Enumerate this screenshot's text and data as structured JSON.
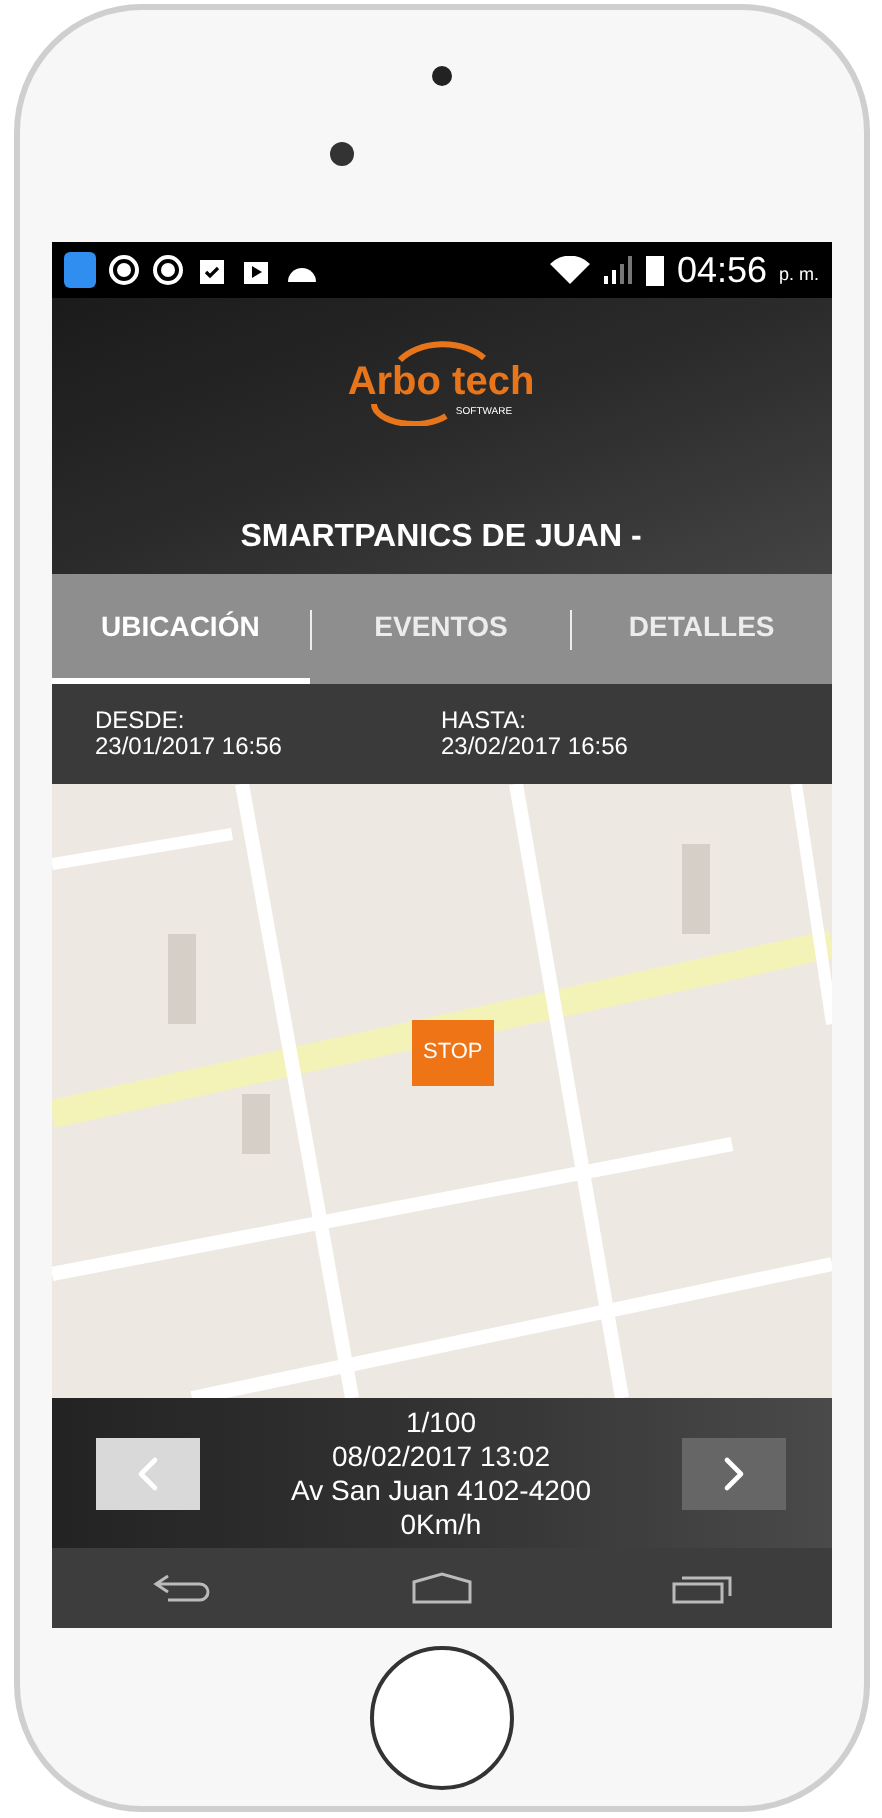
{
  "status_bar": {
    "time": "04:56",
    "meridiem": "p. m."
  },
  "header": {
    "logo": {
      "name": "Arbo tech",
      "tagline": "SOFTWARE"
    },
    "title": "SMARTPANICS DE JUAN -"
  },
  "tabs": [
    {
      "label": "UBICACIÓN",
      "selected": true
    },
    {
      "label": "EVENTOS",
      "selected": false
    },
    {
      "label": "DETALLES",
      "selected": false
    }
  ],
  "range": {
    "from": {
      "label": "DESDE:",
      "value": "23/01/2017 16:56"
    },
    "to": {
      "label": "HASTA:",
      "value": "23/02/2017 16:56"
    }
  },
  "map": {
    "marker": "STOP"
  },
  "record": {
    "counter": "1/100",
    "datetime": "08/02/2017 13:02",
    "address": "Av San Juan 4102-4200",
    "speed": "0Km/h"
  }
}
